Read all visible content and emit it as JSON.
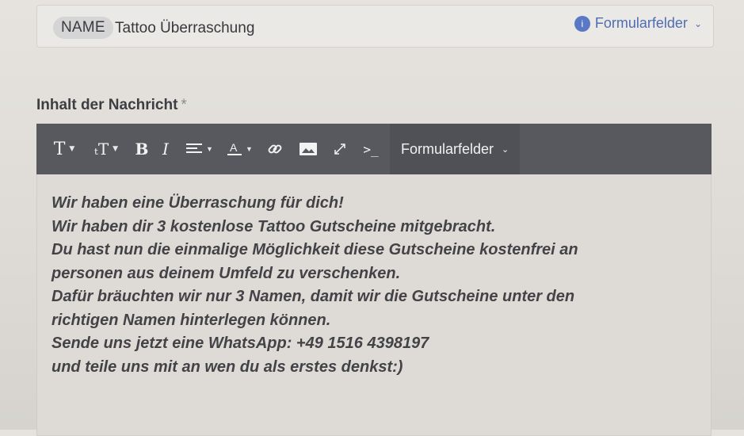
{
  "name_row": {
    "chip_label": "NAME",
    "value": "Tattoo Überraschung",
    "fields_link": "Formularfelder"
  },
  "message": {
    "label": "Inhalt der Nachricht",
    "required_marker": "*"
  },
  "toolbar": {
    "font_icon": "T",
    "size_icon": "ₜT",
    "bold": "B",
    "italic": "I",
    "code_icon": ">_",
    "fields_label": "Formularfelder"
  },
  "icons": [
    "info-icon",
    "chevron-down-icon",
    "font-family-icon",
    "font-size-icon",
    "bold-icon",
    "italic-icon",
    "align-icon",
    "text-color-icon",
    "link-icon",
    "image-icon",
    "expand-icon",
    "code-view-icon"
  ],
  "colors": {
    "toolbar_bg": "#58595f",
    "link_blue": "#4e6db3",
    "text": "#434347"
  },
  "editor": {
    "lines": [
      "Wir haben eine Überraschung für dich!",
      "Wir haben dir 3 kostenlose Tattoo Gutscheine mitgebracht.",
      "Du hast nun die einmalige Möglichkeit diese Gutscheine kostenfrei an",
      "personen aus deinem Umfeld zu verschenken.",
      "Dafür bräuchten wir nur 3 Namen, damit wir die Gutscheine unter den",
      "richtigen Namen hinterlegen können.",
      "Sende uns jetzt eine WhatsApp: +49 1516 4398197",
      "und teile uns mit an wen du als erstes denkst:)"
    ]
  }
}
